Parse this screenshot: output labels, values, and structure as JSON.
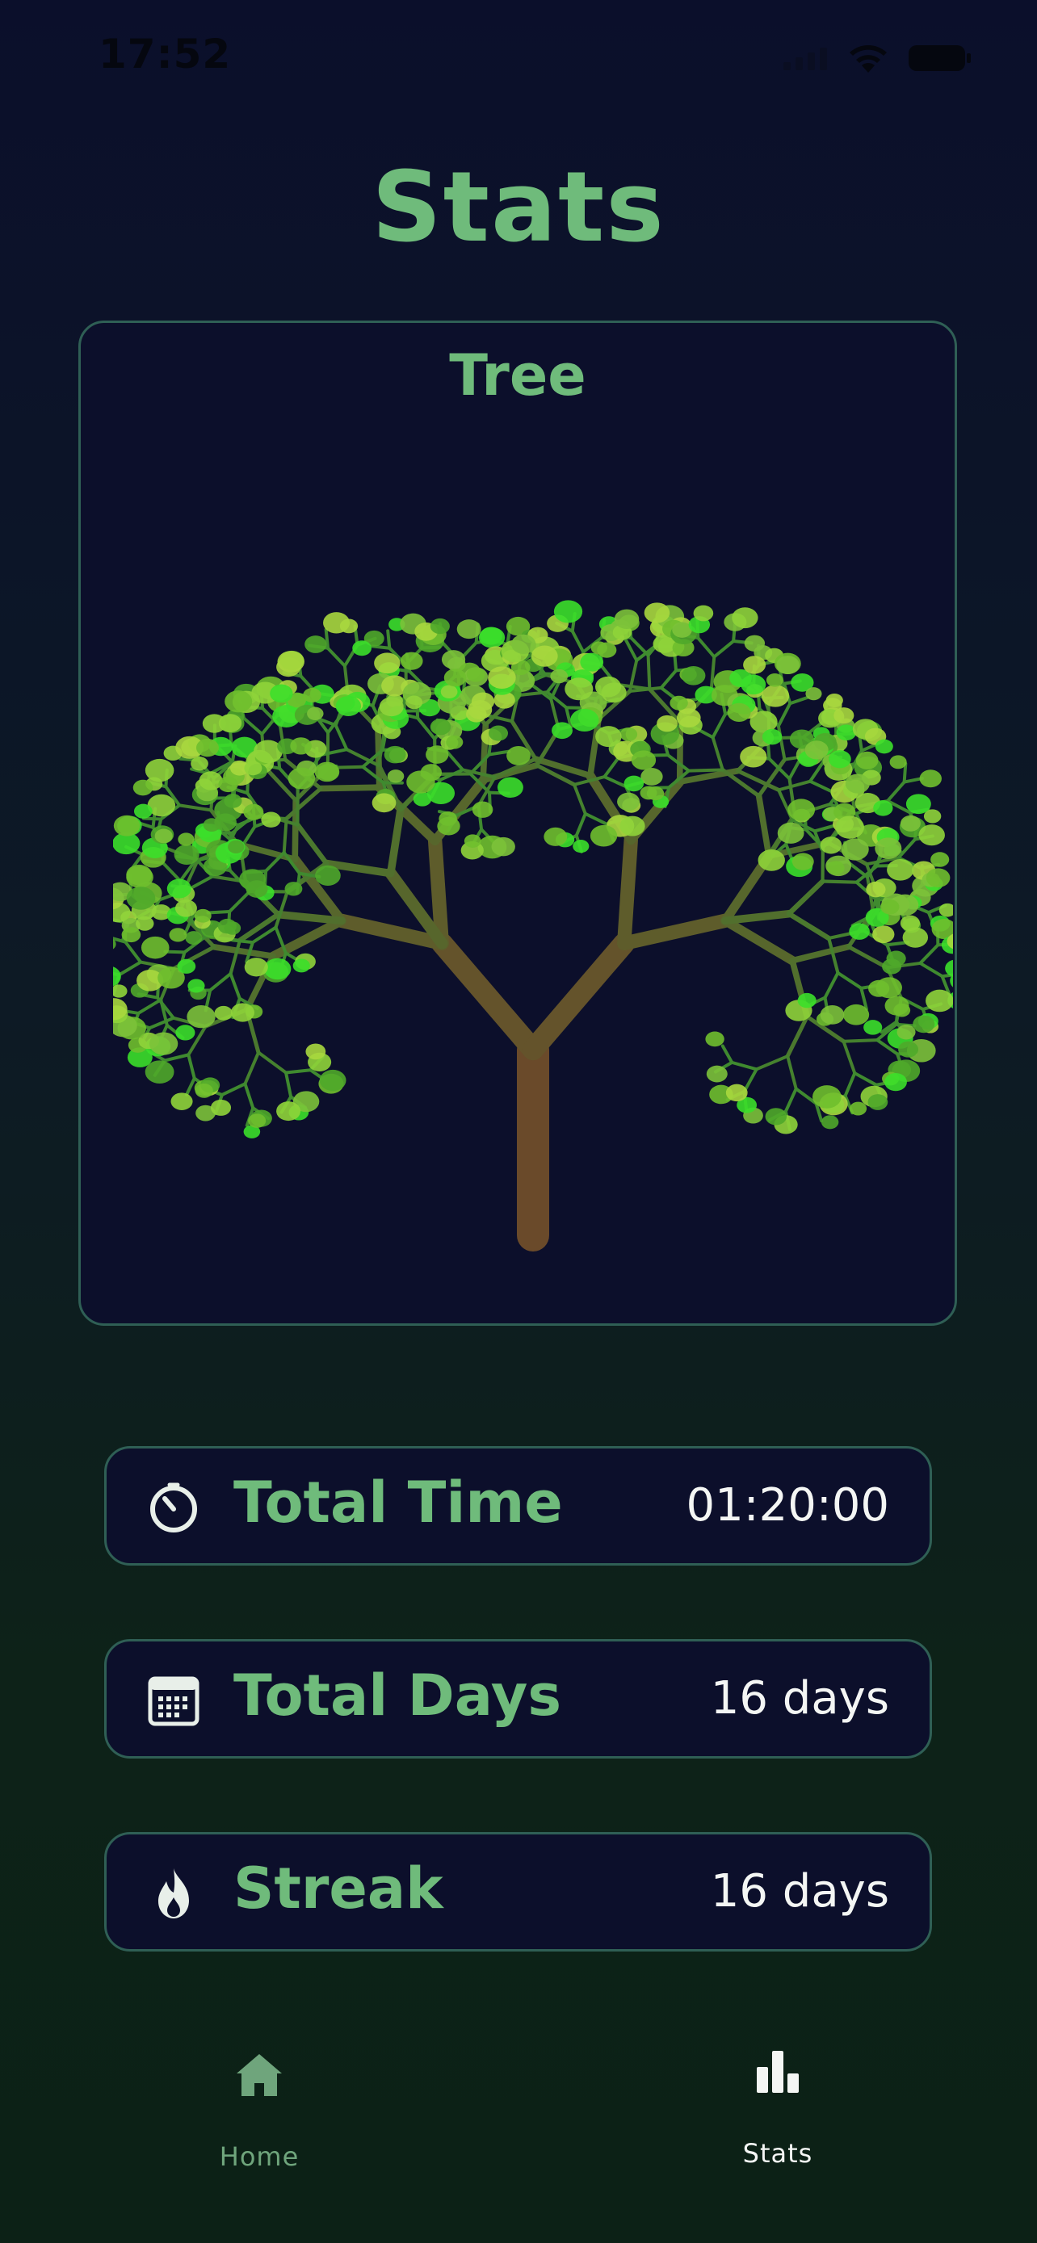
{
  "status_bar": {
    "time": "17:52"
  },
  "page": {
    "title": "Stats"
  },
  "tree_card": {
    "title": "Tree"
  },
  "stats": [
    {
      "label": "Total Time",
      "value": "01:20:00",
      "icon": "timer-icon"
    },
    {
      "label": "Total Days",
      "value": "16 days",
      "icon": "calendar-icon"
    },
    {
      "label": "Streak",
      "value": "16 days",
      "icon": "flame-icon"
    }
  ],
  "tab_bar": {
    "items": [
      {
        "label": "Home",
        "icon": "home-icon",
        "selected": false
      },
      {
        "label": "Stats",
        "icon": "bar-chart-icon",
        "selected": true
      }
    ]
  },
  "colors": {
    "accent_green": "#6fbb7b",
    "card_background": "#0c0f2b",
    "card_border": "#2f5f55",
    "value_text": "#f4f6f4",
    "trunk": "#6a4a2a"
  }
}
